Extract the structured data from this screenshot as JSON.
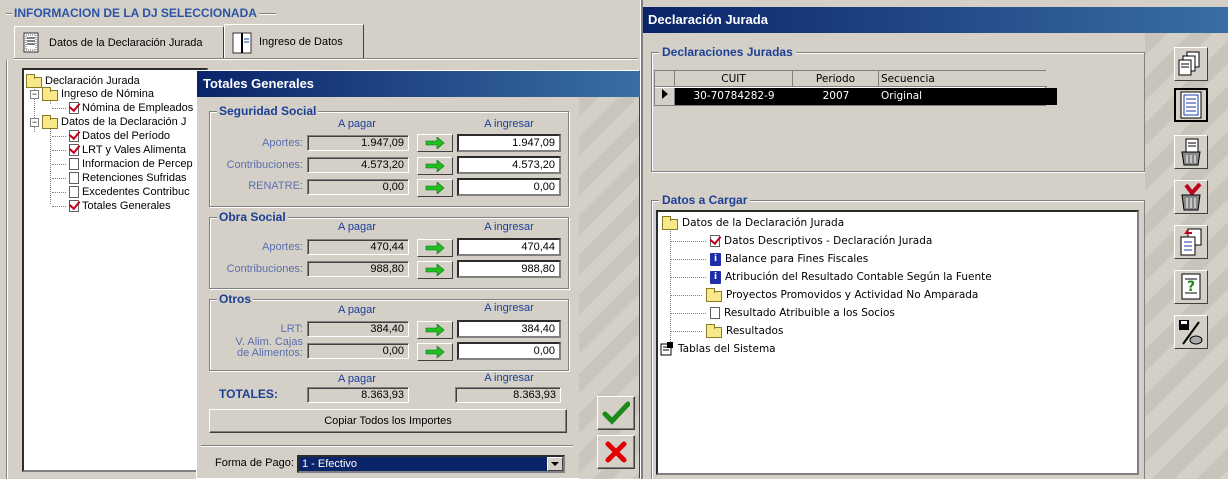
{
  "left": {
    "group_title": "INFORMACION DE LA DJ SELECCIONADA",
    "tabs": [
      {
        "label": "Datos de la Declaración Jurada",
        "icon": "document-icon"
      },
      {
        "label": "Ingreso de Datos",
        "icon": "folder-pages-icon"
      }
    ],
    "tree": [
      {
        "label": "Declaración Jurada"
      },
      {
        "label": "Ingreso de Nómina"
      },
      {
        "label": "Nómina de Empleados"
      },
      {
        "label": "Datos de la Declaración J"
      },
      {
        "label": "Datos del Período"
      },
      {
        "label": "LRT y Vales Alimenta"
      },
      {
        "label": "Informacion de Percep"
      },
      {
        "label": "Retenciones Sufridas"
      },
      {
        "label": "Excedentes Contribuc"
      },
      {
        "label": "Totales Generales"
      }
    ]
  },
  "dialog": {
    "title": "Totales Generales",
    "col_a_pagar": "A pagar",
    "col_a_ingresar": "A ingresar",
    "seguridad_social": {
      "title": "Seguridad Social",
      "rows": [
        {
          "label": "Aportes:",
          "pagar": "1.947,09",
          "ingresar": "1.947,09"
        },
        {
          "label": "Contribuciones:",
          "pagar": "4.573,20",
          "ingresar": "4.573,20"
        },
        {
          "label": "RENATRE:",
          "pagar": "0,00",
          "ingresar": "0,00"
        }
      ]
    },
    "obra_social": {
      "title": "Obra Social",
      "rows": [
        {
          "label": "Aportes:",
          "pagar": "470,44",
          "ingresar": "470,44"
        },
        {
          "label": "Contribuciones:",
          "pagar": "988,80",
          "ingresar": "988,80"
        }
      ]
    },
    "otros": {
      "title": "Otros",
      "rows": [
        {
          "label": "LRT:",
          "pagar": "384,40",
          "ingresar": "384,40"
        },
        {
          "label_line1": "V. Alim. Cajas",
          "label_line2": "de Alimentos:",
          "pagar": "0,00",
          "ingresar": "0,00"
        }
      ]
    },
    "totales": {
      "label": "TOTALES:",
      "pagar": "8.363,93",
      "ingresar": "8.363,93"
    },
    "copy_button": "Copiar Todos los Importes",
    "forma_pago_label": "Forma de Pago:",
    "forma_pago_value": "1 - Efectivo"
  },
  "right": {
    "title": "Declaración Jurada",
    "declaraciones_title": "Declaraciones Juradas",
    "grid_headers": [
      "CUIT",
      "Periodo",
      "Secuencia"
    ],
    "grid_rows": [
      {
        "cuit": "30-70784282-9",
        "periodo": "2007",
        "secuencia": "Original"
      }
    ],
    "datos_title": "Datos a Cargar",
    "tree": [
      {
        "label": "Datos de la Declaración Jurada"
      },
      {
        "label": "Datos Descriptivos - Declaración Jurada"
      },
      {
        "label": "Balance para Fines Fiscales"
      },
      {
        "label": "Atribución del Resultado Contable Según la Fuente"
      },
      {
        "label": "Proyectos Promovidos y Actividad No Amparada"
      },
      {
        "label": "Resultado Atribuible a los Socios"
      },
      {
        "label": "Resultados"
      },
      {
        "label": "Tablas del Sistema"
      }
    ],
    "toolbar_icons": [
      "new-document-icon",
      "list-document-icon",
      "delete-document-icon",
      "delete-checked-icon",
      "import-document-icon",
      "help-document-icon",
      "save-disk-icon"
    ]
  },
  "colors": {
    "titlebar_start": "#0a246a",
    "titlebar_end": "#3a6ea5",
    "group_title": "#2b54a6",
    "checkmark_red": "#c0001c",
    "ok_green": "#1a8a1a",
    "cancel_red": "#e00000"
  }
}
